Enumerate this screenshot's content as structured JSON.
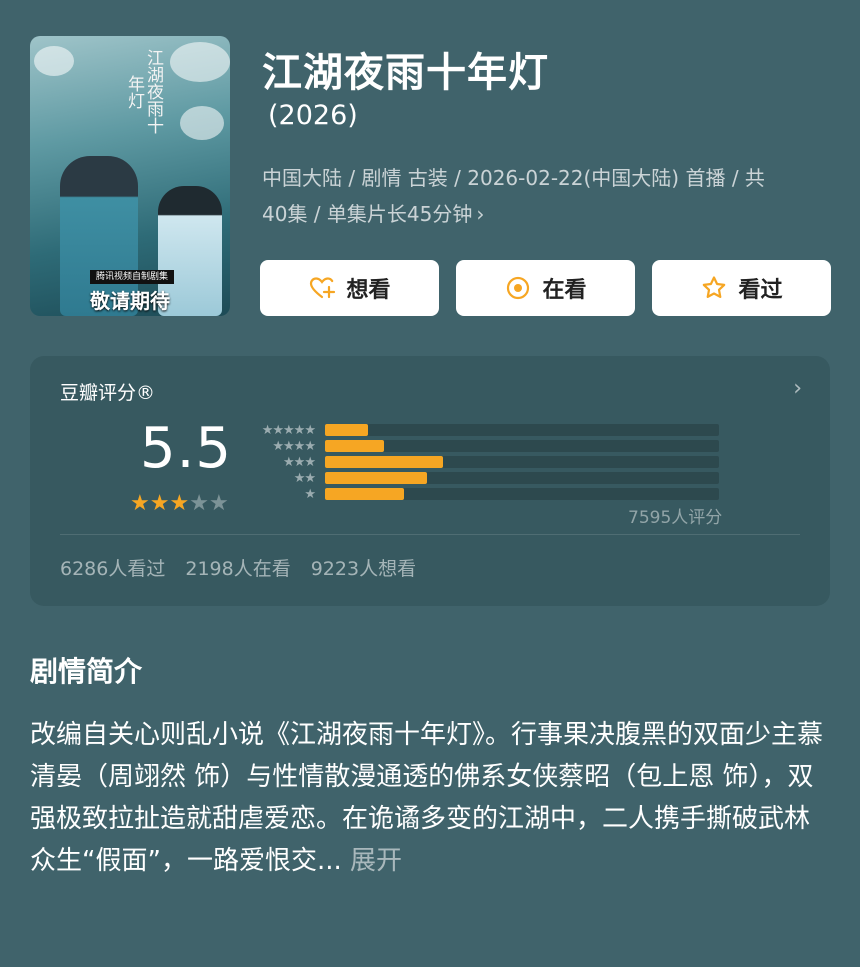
{
  "poster": {
    "calligraphy": "江湖夜雨十年灯",
    "badge_small": "腾讯视频自制剧集",
    "badge_big": "敬请期待"
  },
  "header": {
    "title": "江湖夜雨十年灯",
    "year": "(2026)",
    "meta_line1": "中国大陆 / 剧情 古装 / 2026-02-22(中国大陆) 首播 / 共",
    "meta_line2": "40集 / 单集片长45分钟",
    "chevron": "›"
  },
  "actions": [
    {
      "label": "想看",
      "icon": "heart-plus-icon"
    },
    {
      "label": "在看",
      "icon": "target-circle-icon"
    },
    {
      "label": "看过",
      "icon": "star-outline-icon"
    }
  ],
  "rating": {
    "title": "豆瓣评分®",
    "arrow": "›",
    "score": "5.5",
    "stars_filled": 3,
    "stars_total": 5,
    "distribution": [
      {
        "stars": "★★★★★",
        "fraction": 0.11
      },
      {
        "stars": "★★★★",
        "fraction": 0.15
      },
      {
        "stars": "★★★",
        "fraction": 0.3
      },
      {
        "stars": "★★",
        "fraction": 0.26
      },
      {
        "stars": "★",
        "fraction": 0.2
      }
    ],
    "votes": "7595人评分",
    "counts": [
      "6286人看过",
      "2198人在看",
      "9223人想看"
    ]
  },
  "synopsis": {
    "title": "剧情简介",
    "text": "改编自关心则乱小说《江湖夜雨十年灯》。行事果决腹黑的双面少主慕清晏（周翊然 饰）与性情散漫通透的佛系女侠蔡昭（包上恩 饰），双强极致拉扯造就甜虐爱恋。在诡谲多变的江湖中，二人携手撕破武林众生“假面”，一路爱恨交...",
    "more": "展开"
  },
  "colors": {
    "background": "#40636b",
    "card": "#375960",
    "accent": "#f6a623"
  }
}
